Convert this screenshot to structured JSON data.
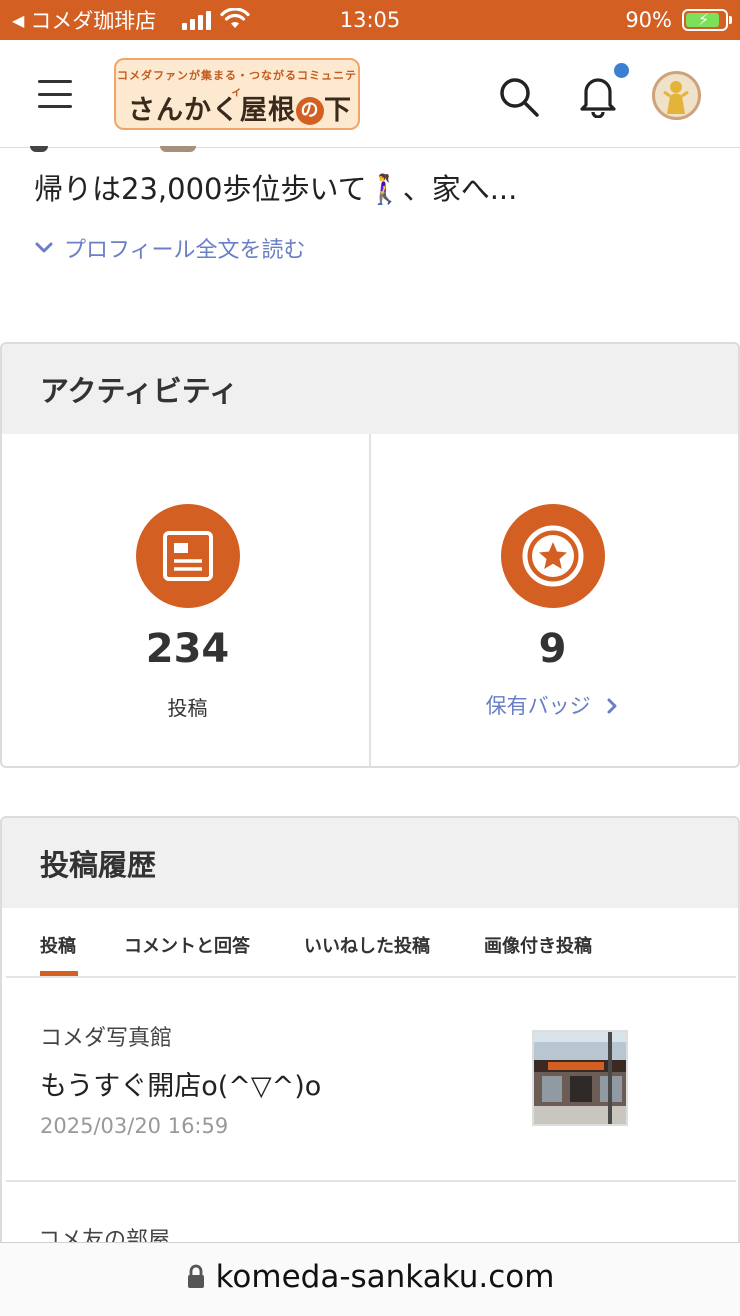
{
  "status_bar": {
    "back_app": "コメダ珈琲店",
    "time": "13:05",
    "battery": "90%"
  },
  "header": {
    "logo_tagline": "コメダファンが集まる・つながるコミュニティ",
    "logo_title_pre": "さんかく屋根",
    "logo_title_no": "の",
    "logo_title_post": "下"
  },
  "profile": {
    "bio_excerpt": "帰りは23,000歩位歩いて🚶‍♀️、家へ...",
    "read_more": "プロフィール全文を読む"
  },
  "activity": {
    "title": "アクティビティ",
    "posts_count": "234",
    "posts_label": "投稿",
    "badges_count": "9",
    "badges_label": "保有バッジ"
  },
  "history": {
    "title": "投稿履歴",
    "tabs": [
      "投稿",
      "コメントと回答",
      "いいねした投稿",
      "画像付き投稿"
    ],
    "posts": [
      {
        "category": "コメダ写真館",
        "title": "もうすぐ開店o(^▽^)o",
        "date": "2025/03/20 16:59"
      },
      {
        "category": "コメ友の部屋"
      }
    ]
  },
  "url_bar": {
    "url": "komeda-sankaku.com"
  },
  "colors": {
    "accent": "#d45f23",
    "link": "#6a7fc6",
    "notification_dot": "#3a7fd0"
  }
}
